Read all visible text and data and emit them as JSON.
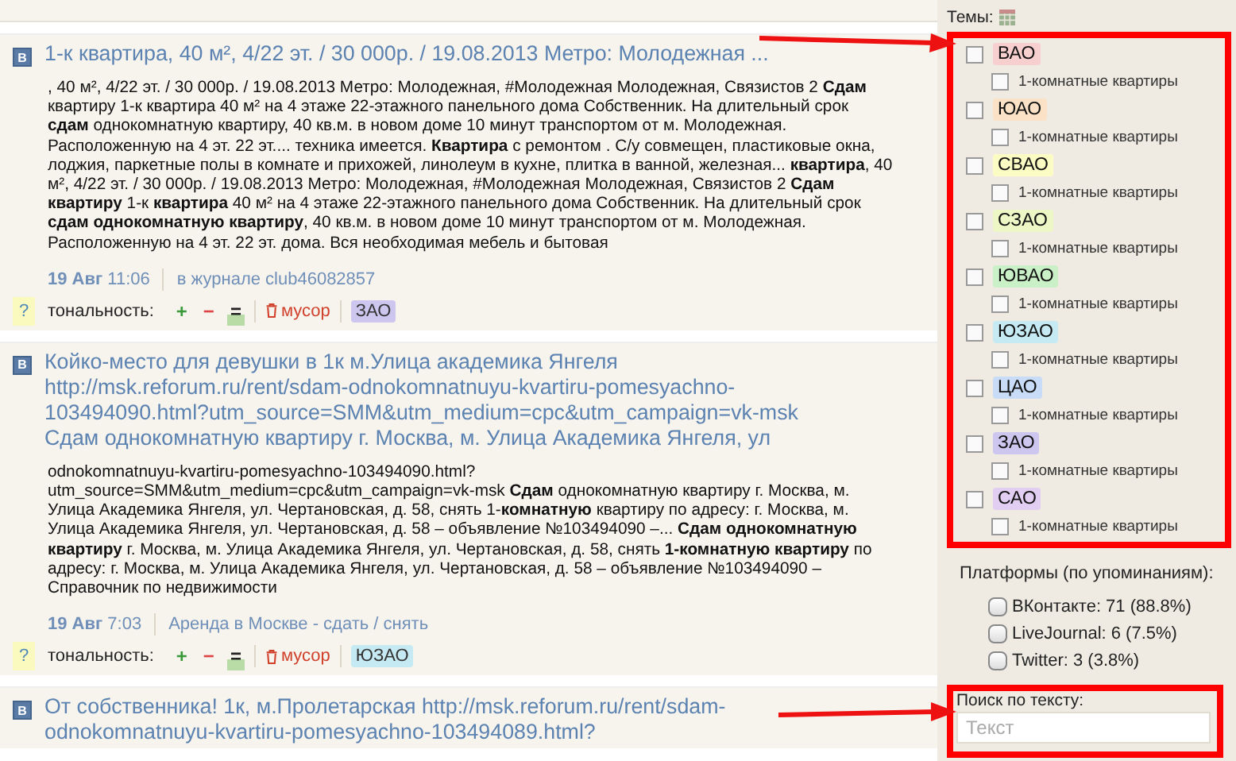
{
  "posts": [
    {
      "source_icon": "B",
      "title": "1-к квартира, 40 м², 4/22 эт. / 30 000р. / 19.08.2013 Метро: Молодежная ...",
      "body": ", 40 м², 4/22 эт. / 30 000р. / 19.08.2013 Метро: Молодежная, #Молодежная Молодежная, Связистов 2 **Сдам** квартиру 1-к квартира 40 м² на 4 этаже 22-этажного панельного дома Собственник. На длительный срок **сдам** однокомнатную квартиру, 40 кв.м. в новом доме 10 минут транспортом от м. Молодежная. Расположенную на 4 эт. 22 эт.... техника имеется. **Квартира** с ремонтом . С/у совмещен, пластиковые окна, лоджия, паркетные полы в комнате и прихожей, линолеум в кухне, плитка в ванной, железная... **квартира**, 40 м², 4/22 эт. / 30 000р. / 19.08.2013 Метро: Молодежная, #Молодежная Молодежная, Связистов 2 **Сдам квартиру** 1-к **квартира** 40 м² на 4 этаже 22-этажного панельного дома Собственник. На длительный срок **сдам однокомнатную квартиру**, 40 кв.м. в новом доме 10 минут транспортом от м. Молодежная. Расположенную на 4 эт. 22 эт. дома. Вся необходимая мебель и бытовая",
      "date": "19 Авг",
      "time": "11:06",
      "source": "в журнале club46082857",
      "help": "?",
      "tonality_label": "тональность:",
      "tonality": [
        {
          "label": "+",
          "kind": "positive",
          "selected": false
        },
        {
          "label": "−",
          "kind": "negative",
          "selected": false
        },
        {
          "label": "=",
          "kind": "neutral",
          "selected": true
        }
      ],
      "trash": "мусор",
      "tag": {
        "label": "ЗАО",
        "color": "#cdc6ef"
      }
    },
    {
      "source_icon": "B",
      "title": "Койко-место для девушки в 1к м.Улица академика Янгеля http://msk.reforum.ru/rent/sdam-odnokomnatnuyu-kvartiru-pomesyachno-103494090.html?utm_source=SMM&utm_medium=cpc&utm_campaign=vk-msk Сдам однокомнатную квартиру г. Москва, м. Улица Академика Янгеля, ул",
      "body": "odnokomnatnuyu-kvartiru-pomesyachno-103494090.html? utm_source=SMM&utm_medium=cpc&utm_campaign=vk-msk **Сдам** однокомнатную квартиру г. Москва, м. Улица Академика Янгеля, ул. Чертановская, д. 58, снять 1-**комнатную** квартиру по адресу: г. Москва, м. Улица Академика Янгеля, ул. Чертановская, д. 58 – объявление №103494090 –... **Сдам однокомнатную квартиру** г. Москва, м. Улица Академика Янгеля, ул. Чертановская, д. 58, снять **1-комнатную квартиру** по адресу: г. Москва, м. Улица Академика Янгеля, ул. Чертановская, д. 58 – объявление №103494090 – Справочник по недвижимости",
      "date": "19 Авг",
      "time": "7:03",
      "source": "Аренда в Москве - сдать / снять",
      "help": "?",
      "tonality_label": "тональность:",
      "tonality": [
        {
          "label": "+",
          "kind": "positive",
          "selected": false
        },
        {
          "label": "−",
          "kind": "negative",
          "selected": false
        },
        {
          "label": "=",
          "kind": "neutral",
          "selected": true
        }
      ],
      "trash": "мусор",
      "tag": {
        "label": "ЮЗАО",
        "color": "#c6eaf3"
      }
    },
    {
      "source_icon": "B",
      "title": "От собственника! 1к, м.Пролетарская http://msk.reforum.ru/rent/sdam-odnokomnatnuyu-kvartiru-pomesyachno-103494089.html?"
    }
  ],
  "sidebar": {
    "topics_label": "Темы:",
    "topics": [
      {
        "label": "ВАО",
        "color": "#f8cfcf",
        "checked": false,
        "sub": {
          "label": "1-комнатные квартиры",
          "checked": false
        }
      },
      {
        "label": "ЮАО",
        "color": "#fbe2c6",
        "checked": false,
        "sub": {
          "label": "1-комнатные квартиры",
          "checked": false
        }
      },
      {
        "label": "СВАО",
        "color": "#fbfbc4",
        "checked": false,
        "sub": {
          "label": "1-комнатные квартиры",
          "checked": false
        }
      },
      {
        "label": "СЗАО",
        "color": "#edf7c6",
        "checked": false,
        "sub": {
          "label": "1-комнатные квартиры",
          "checked": false
        }
      },
      {
        "label": "ЮВАО",
        "color": "#c9f0c6",
        "checked": false,
        "sub": {
          "label": "1-комнатные квартиры",
          "checked": false
        }
      },
      {
        "label": "ЮЗАО",
        "color": "#c6eaf3",
        "checked": false,
        "sub": {
          "label": "1-комнатные квартиры",
          "checked": false
        }
      },
      {
        "label": "ЦАО",
        "color": "#c8dbf7",
        "checked": false,
        "sub": {
          "label": "1-комнатные квартиры",
          "checked": false
        }
      },
      {
        "label": "ЗАО",
        "color": "#cdc6ef",
        "checked": false,
        "sub": {
          "label": "1-комнатные квартиры",
          "checked": false
        }
      },
      {
        "label": "САО",
        "color": "#e2cdf3",
        "checked": false,
        "sub": {
          "label": "1-комнатные квартиры",
          "checked": false
        }
      }
    ],
    "platforms_label": "Платформы (по упоминаниям):",
    "platforms": [
      {
        "label": "ВКонтакте: 71 (88.8%)",
        "checked": false
      },
      {
        "label": "LiveJournal: 6 (7.5%)",
        "checked": false
      },
      {
        "label": "Twitter: 3 (3.8%)",
        "checked": false
      }
    ],
    "search": {
      "label": "Поиск по тексту:",
      "placeholder": "Текст"
    }
  }
}
